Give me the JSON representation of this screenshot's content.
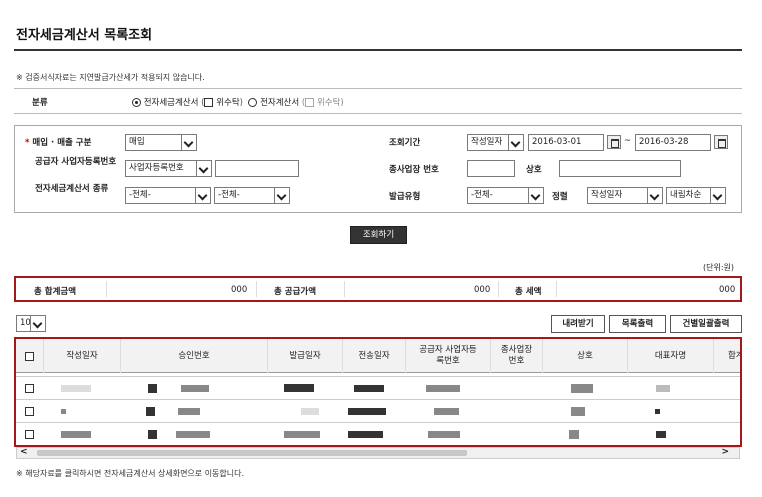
{
  "title": "전자세금계산서 목록조회",
  "notice_top": "※ 검증서식자료는 지연발급가산세가 적용되지 않습니다.",
  "category": {
    "label": "분류",
    "options": [
      {
        "label": "전자세금계산서",
        "selected": true
      },
      {
        "label": "위수탁",
        "type": "checkbox"
      },
      {
        "label": "전자계산서",
        "selected": false
      },
      {
        "label": "위수탁",
        "type": "checkbox",
        "disabled": true
      }
    ]
  },
  "filters": {
    "sales_type_label": "매입 · 매출 구분",
    "sales_type_value": "매입",
    "period_label": "조회기간",
    "period_type_value": "작성일자",
    "date_from": "2016-03-01",
    "date_to": "2016-03-28",
    "date_sep": "~",
    "supplier_label": "공급자 사업자등록번호",
    "supplier_type_value": "사업자등록번호",
    "branch_label": "종사업장 번호",
    "trade_name_label": "상호",
    "type_label": "전자세금계산서 종류",
    "type_value_1": "-전체-",
    "type_value_2": "-전체-",
    "issue_type_label": "발급유형",
    "issue_type_value": "-전체-",
    "sort_label": "정렬",
    "sort_value": "작성일자",
    "order_value": "내림차순"
  },
  "search_button": "조회하기",
  "unit_label": "(단위:원)",
  "summary": {
    "total_label": "총 합계금액",
    "total_value": "000",
    "supply_label": "총 공급가액",
    "supply_value": "000",
    "tax_label": "총 세액",
    "tax_value": "000"
  },
  "page_size": "10",
  "actions": {
    "download": "내려받기",
    "print_list": "목록출력",
    "print_each": "건별일괄출력"
  },
  "table": {
    "headers": [
      "작성일자",
      "승인번호",
      "발급일자",
      "전송일자",
      "공급자 사업자등록번호",
      "종사업장 번호",
      "상호",
      "대표자명",
      "합계"
    ]
  },
  "notice_bottom": "※ 해당자료를 클릭하시면 전자세금계산서 상세화면으로 이동합니다."
}
